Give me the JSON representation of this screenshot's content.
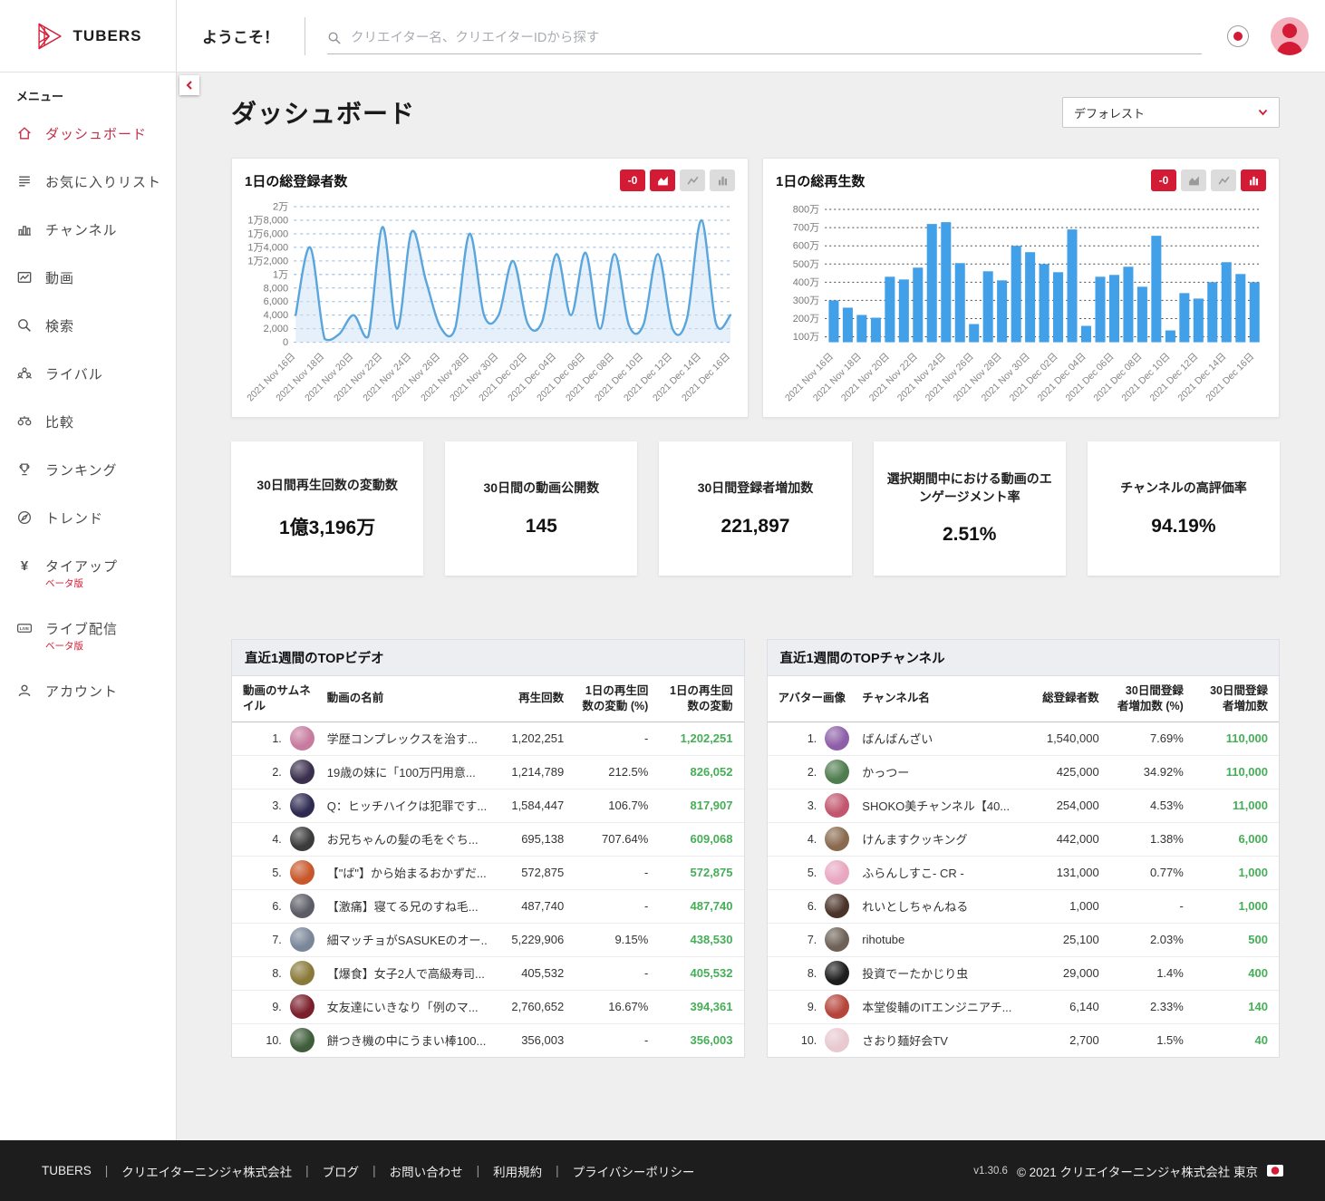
{
  "colors": {
    "accent": "#d41b35",
    "green": "#45ae57",
    "bar_blue": "#41a0e8",
    "line_blue": "#59a5dc"
  },
  "header": {
    "brand": "TUBERS",
    "welcome": "ようこそ！",
    "search_placeholder": "クリエイター名、クリエイターIDから探す"
  },
  "sidebar": {
    "menu_label": "メニュー",
    "items": [
      {
        "key": "dashboard",
        "icon": "home-icon",
        "label": "ダッシュボード",
        "active": true
      },
      {
        "key": "favorites",
        "icon": "list-icon",
        "label": "お気に入りリスト"
      },
      {
        "key": "channels",
        "icon": "bar-chart-icon",
        "label": "チャンネル"
      },
      {
        "key": "videos",
        "icon": "video-frame-icon",
        "label": "動画"
      },
      {
        "key": "search",
        "icon": "search-icon",
        "label": "検索"
      },
      {
        "key": "rivals",
        "icon": "people-icon",
        "label": "ライバル"
      },
      {
        "key": "compare",
        "icon": "scale-icon",
        "label": "比較"
      },
      {
        "key": "ranking",
        "icon": "trophy-icon",
        "label": "ランキング"
      },
      {
        "key": "trend",
        "icon": "compass-icon",
        "label": "トレンド"
      },
      {
        "key": "tieup",
        "icon": "yen-icon",
        "label": "タイアップ",
        "beta": "ベータ版"
      },
      {
        "key": "live",
        "icon": "live-icon",
        "label": "ライブ配信",
        "beta": "ベータ版"
      },
      {
        "key": "account",
        "icon": "person-icon",
        "label": "アカウント"
      }
    ]
  },
  "page": {
    "title": "ダッシュボード",
    "preset_value": "デフォレスト"
  },
  "chart_data": [
    {
      "type": "area",
      "title": "1日の総登録者数",
      "badge": "-0",
      "active_view": "area",
      "unit": "",
      "dates": [
        "2021-11-16",
        "2021-11-17",
        "2021-11-18",
        "2021-11-19",
        "2021-11-20",
        "2021-11-21",
        "2021-11-22",
        "2021-11-23",
        "2021-11-24",
        "2021-11-25",
        "2021-11-26",
        "2021-11-27",
        "2021-11-28",
        "2021-11-29",
        "2021-11-30",
        "2021-12-01",
        "2021-12-02",
        "2021-12-03",
        "2021-12-04",
        "2021-12-05",
        "2021-12-06",
        "2021-12-07",
        "2021-12-08",
        "2021-12-09",
        "2021-12-10",
        "2021-12-11",
        "2021-12-12",
        "2021-12-13",
        "2021-12-14",
        "2021-12-15",
        "2021-12-16"
      ],
      "x_tick_labels": [
        "2021 Nov 16日",
        "2021 Nov 18日",
        "2021 Nov 20日",
        "2021 Nov 22日",
        "2021 Nov 24日",
        "2021 Nov 26日",
        "2021 Nov 28日",
        "2021 Nov 30日",
        "2021 Dec 02日",
        "2021 Dec 04日",
        "2021 Dec 06日",
        "2021 Dec 08日",
        "2021 Dec 10日",
        "2021 Dec 12日",
        "2021 Dec 14日",
        "2021 Dec 16日"
      ],
      "values": [
        4000,
        14000,
        500,
        1200,
        4000,
        800,
        17000,
        2000,
        16300,
        9000,
        2200,
        2000,
        16000,
        4000,
        4000,
        12000,
        2800,
        3000,
        13000,
        4000,
        13200,
        2000,
        13000,
        2500,
        2600,
        13000,
        2000,
        3500,
        18000,
        2800,
        4000
      ],
      "ymin": 0,
      "ymax": 20400,
      "yticks": [
        {
          "value": 20000,
          "label": "2万"
        },
        {
          "value": 18000,
          "label": "1万8,000"
        },
        {
          "value": 16000,
          "label": "1万6,000"
        },
        {
          "value": 14000,
          "label": "1万4,000"
        },
        {
          "value": 12000,
          "label": "1万2,000"
        },
        {
          "value": 10000,
          "label": "1万"
        },
        {
          "value": 8000,
          "label": "8,000"
        },
        {
          "value": 6000,
          "label": "6,000"
        },
        {
          "value": 4000,
          "label": "4,000"
        },
        {
          "value": 2000,
          "label": "2,000"
        },
        {
          "value": 0,
          "label": "0"
        }
      ],
      "line_color": "#59a5dc",
      "fill_color": "#cfe4f6",
      "grid_color": "#93b5dd",
      "grid_dash": "3,4"
    },
    {
      "type": "bar",
      "title": "1日の総再生数",
      "badge": "-0",
      "active_view": "bar",
      "unit": "万",
      "dates": [
        "2021-11-16",
        "2021-11-17",
        "2021-11-18",
        "2021-11-19",
        "2021-11-20",
        "2021-11-21",
        "2021-11-22",
        "2021-11-23",
        "2021-11-24",
        "2021-11-25",
        "2021-11-26",
        "2021-11-27",
        "2021-11-28",
        "2021-11-29",
        "2021-11-30",
        "2021-12-01",
        "2021-12-02",
        "2021-12-03",
        "2021-12-04",
        "2021-12-05",
        "2021-12-06",
        "2021-12-07",
        "2021-12-08",
        "2021-12-09",
        "2021-12-10",
        "2021-12-11",
        "2021-12-12",
        "2021-12-13",
        "2021-12-14",
        "2021-12-15",
        "2021-12-16"
      ],
      "x_tick_labels": [
        "2021 Nov 16日",
        "2021 Nov 18日",
        "2021 Nov 20日",
        "2021 Nov 22日",
        "2021 Nov 24日",
        "2021 Nov 26日",
        "2021 Nov 28日",
        "2021 Nov 30日",
        "2021 Dec 02日",
        "2021 Dec 04日",
        "2021 Dec 06日",
        "2021 Dec 08日",
        "2021 Dec 10日",
        "2021 Dec 12日",
        "2021 Dec 14日",
        "2021 Dec 16日"
      ],
      "values": [
        300,
        260,
        220,
        205,
        430,
        415,
        480,
        720,
        730,
        505,
        170,
        460,
        410,
        600,
        565,
        500,
        455,
        690,
        160,
        430,
        440,
        485,
        375,
        655,
        135,
        340,
        310,
        400,
        510,
        445,
        400
      ],
      "ymin": 70,
      "ymax": 830,
      "yticks": [
        {
          "value": 800,
          "label": "800万"
        },
        {
          "value": 700,
          "label": "700万"
        },
        {
          "value": 600,
          "label": "600万"
        },
        {
          "value": 500,
          "label": "500万"
        },
        {
          "value": 400,
          "label": "400万"
        },
        {
          "value": 300,
          "label": "300万"
        },
        {
          "value": 200,
          "label": "200万"
        },
        {
          "value": 100,
          "label": "100万"
        }
      ],
      "bar_color": "#41a0e8",
      "grid_color": "#4a4a4a",
      "grid_dash": "2,3"
    }
  ],
  "cards": [
    {
      "label": "30日間再生回数の変動数",
      "value": "1億3,196万"
    },
    {
      "label": "30日間の動画公開数",
      "value": "145"
    },
    {
      "label": "30日間登録者増加数",
      "value": "221,897"
    },
    {
      "label": "選択期間中における動画のエンゲージメント率",
      "value": "2.51%"
    },
    {
      "label": "チャンネルの高評価率",
      "value": "94.19%"
    }
  ],
  "tables": {
    "videos": {
      "title": "直近1週間のTOPビデオ",
      "columns": [
        "動画のサムネイル",
        "動画の名前",
        "再生回数",
        "1日の再生回数の変動 (%)",
        "1日の再生回数の変動"
      ],
      "rows": [
        {
          "rank": "1.",
          "avatar_color": "#c77b9e",
          "name": "学歴コンプレックスを治す...",
          "views": "1,202,251",
          "change_pct": "-",
          "change": "1,202,251"
        },
        {
          "rank": "2.",
          "avatar_color": "#3a2f4d",
          "name": "19歳の妹に「100万円用意...",
          "views": "1,214,789",
          "change_pct": "212.5%",
          "change": "826,052"
        },
        {
          "rank": "3.",
          "avatar_color": "#2e2a52",
          "name": "Q：ヒッチハイクは犯罪です...",
          "views": "1,584,447",
          "change_pct": "106.7%",
          "change": "817,907"
        },
        {
          "rank": "4.",
          "avatar_color": "#3b3b3b",
          "name": "お兄ちゃんの髪の毛をぐち...",
          "views": "695,138",
          "change_pct": "707.64%",
          "change": "609,068"
        },
        {
          "rank": "5.",
          "avatar_color": "#c8572b",
          "name": "【\"ば\"】から始まるおかずだ...",
          "views": "572,875",
          "change_pct": "-",
          "change": "572,875"
        },
        {
          "rank": "6.",
          "avatar_color": "#5c5c66",
          "name": "【激痛】寝てる兄のすね毛...",
          "views": "487,740",
          "change_pct": "-",
          "change": "487,740"
        },
        {
          "rank": "7.",
          "avatar_color": "#7a8699",
          "name": "細マッチョがSASUKEのオー...",
          "views": "5,229,906",
          "change_pct": "9.15%",
          "change": "438,530"
        },
        {
          "rank": "8.",
          "avatar_color": "#8a7a3a",
          "name": "【爆食】女子2人で高級寿司...",
          "views": "405,532",
          "change_pct": "-",
          "change": "405,532"
        },
        {
          "rank": "9.",
          "avatar_color": "#7a1f2b",
          "name": "女友達にいきなり「例のマ...",
          "views": "2,760,652",
          "change_pct": "16.67%",
          "change": "394,361"
        },
        {
          "rank": "10.",
          "avatar_color": "#3f5d3a",
          "name": "餅つき機の中にうまい棒100...",
          "views": "356,003",
          "change_pct": "-",
          "change": "356,003"
        }
      ]
    },
    "channels": {
      "title": "直近1週間のTOPチャンネル",
      "columns": [
        "アバター画像",
        "チャンネル名",
        "総登録者数",
        "30日間登録者増加数 (%)",
        "30日間登録者増加数"
      ],
      "rows": [
        {
          "rank": "1.",
          "avatar_color": "#8e5fa8",
          "name": "ばんばんざい",
          "views": "1,540,000",
          "change_pct": "7.69%",
          "change": "110,000"
        },
        {
          "rank": "2.",
          "avatar_color": "#4f7d4f",
          "name": "かっつー",
          "views": "425,000",
          "change_pct": "34.92%",
          "change": "110,000"
        },
        {
          "rank": "3.",
          "avatar_color": "#c2566e",
          "name": "SHOKO美チャンネル【40...",
          "views": "254,000",
          "change_pct": "4.53%",
          "change": "11,000"
        },
        {
          "rank": "4.",
          "avatar_color": "#8a6a4f",
          "name": "けんますクッキング",
          "views": "442,000",
          "change_pct": "1.38%",
          "change": "6,000"
        },
        {
          "rank": "5.",
          "avatar_color": "#e8a7c0",
          "name": "ふらんしすこ- CR -",
          "views": "131,000",
          "change_pct": "0.77%",
          "change": "1,000"
        },
        {
          "rank": "6.",
          "avatar_color": "#4a3328",
          "name": "れいとしちゃんねる",
          "views": "1,000",
          "change_pct": "-",
          "change": "1,000"
        },
        {
          "rank": "7.",
          "avatar_color": "#6e6258",
          "name": "rihotube",
          "views": "25,100",
          "change_pct": "2.03%",
          "change": "500"
        },
        {
          "rank": "8.",
          "avatar_color": "#1d1d1d",
          "name": "投資でーたかじり虫",
          "views": "29,000",
          "change_pct": "1.4%",
          "change": "400"
        },
        {
          "rank": "9.",
          "avatar_color": "#b5443a",
          "name": "本堂俊輔のITエンジニアチ...",
          "views": "6,140",
          "change_pct": "2.33%",
          "change": "140"
        },
        {
          "rank": "10.",
          "avatar_color": "#e7c9cf",
          "name": "さおり麺好会TV",
          "views": "2,700",
          "change_pct": "1.5%",
          "change": "40"
        }
      ]
    }
  },
  "footer": {
    "links": [
      "TUBERS",
      "クリエイターニンジャ株式会社",
      "ブログ",
      "お問い合わせ",
      "利用規約",
      "プライバシーポリシー"
    ],
    "version": "v1.30.6",
    "copyright": "© 2021 クリエイターニンジャ株式会社 東京"
  }
}
